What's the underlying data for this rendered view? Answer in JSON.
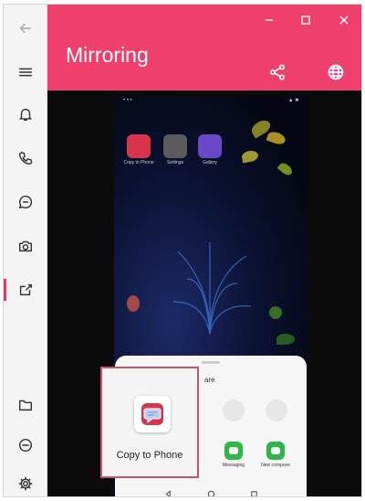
{
  "app": {
    "title": "Mirroring"
  },
  "window_controls": [
    {
      "name": "minimize-icon"
    },
    {
      "name": "maximize-icon"
    },
    {
      "name": "close-icon"
    }
  ],
  "nav_icons": [
    "back-arrow-icon",
    "menu-icon",
    "bell-icon",
    "phone-icon",
    "chat-icon",
    "camera-icon",
    "mirroring-icon",
    "folder-icon",
    "minus-circle-icon",
    "gear-icon"
  ],
  "header_actions": [
    "share-icon",
    "globe-icon"
  ],
  "phone_screen": {
    "apps": [
      {
        "label": "Copy to Phone",
        "color": "#d8344a"
      },
      {
        "label": "Settings",
        "color": "#5b5b5b"
      },
      {
        "label": "Gallery",
        "color": "#6a49c8"
      }
    ]
  },
  "share_sheet": {
    "title": "are",
    "apps": [
      {
        "label": "Messaging"
      },
      {
        "label": "New compose"
      }
    ]
  },
  "copy_to_phone": {
    "label": "Copy to Phone"
  },
  "colors": {
    "accent": "#ee3f6d",
    "highlight": "#c8536f"
  }
}
